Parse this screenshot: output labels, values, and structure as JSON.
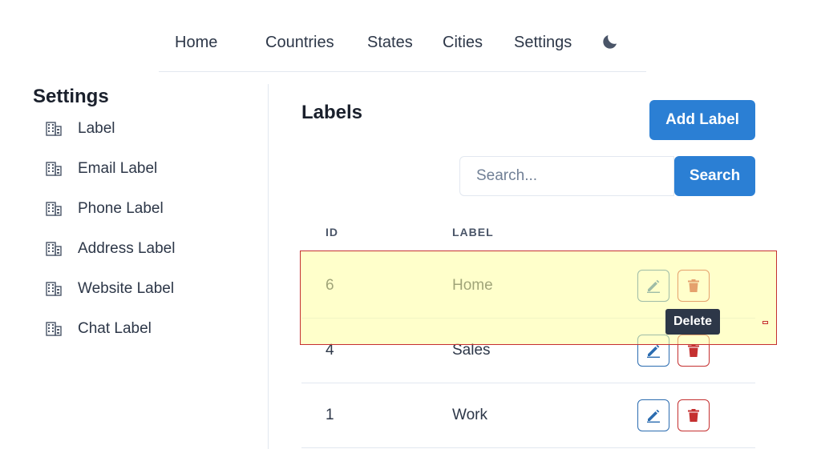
{
  "nav": {
    "items": [
      {
        "label": "Home"
      },
      {
        "label": "Countries"
      },
      {
        "label": "States"
      },
      {
        "label": "Cities"
      },
      {
        "label": "Settings"
      }
    ],
    "theme_icon": "moon-icon"
  },
  "sidebar": {
    "title": "Settings",
    "item_icon": "building-icon",
    "items": [
      {
        "label": "Label"
      },
      {
        "label": "Email Label"
      },
      {
        "label": "Phone Label"
      },
      {
        "label": "Address Label"
      },
      {
        "label": "Website Label"
      },
      {
        "label": "Chat Label"
      }
    ]
  },
  "main": {
    "title": "Labels",
    "add_button": "Add Label",
    "search": {
      "placeholder": "Search...",
      "value": "",
      "button": "Search"
    },
    "table": {
      "headers": [
        "ID",
        "LABEL"
      ],
      "rows": [
        {
          "id": "6",
          "label": "Home"
        },
        {
          "id": "4",
          "label": "Sales"
        },
        {
          "id": "1",
          "label": "Work"
        }
      ],
      "row_actions": [
        "pencil-icon",
        "trash-icon"
      ]
    },
    "tooltip": "Delete"
  },
  "colors": {
    "primary": "#2b7fd4",
    "danger": "#c53030",
    "edit": "#2b6cb0",
    "highlight": "#ffffa0"
  }
}
